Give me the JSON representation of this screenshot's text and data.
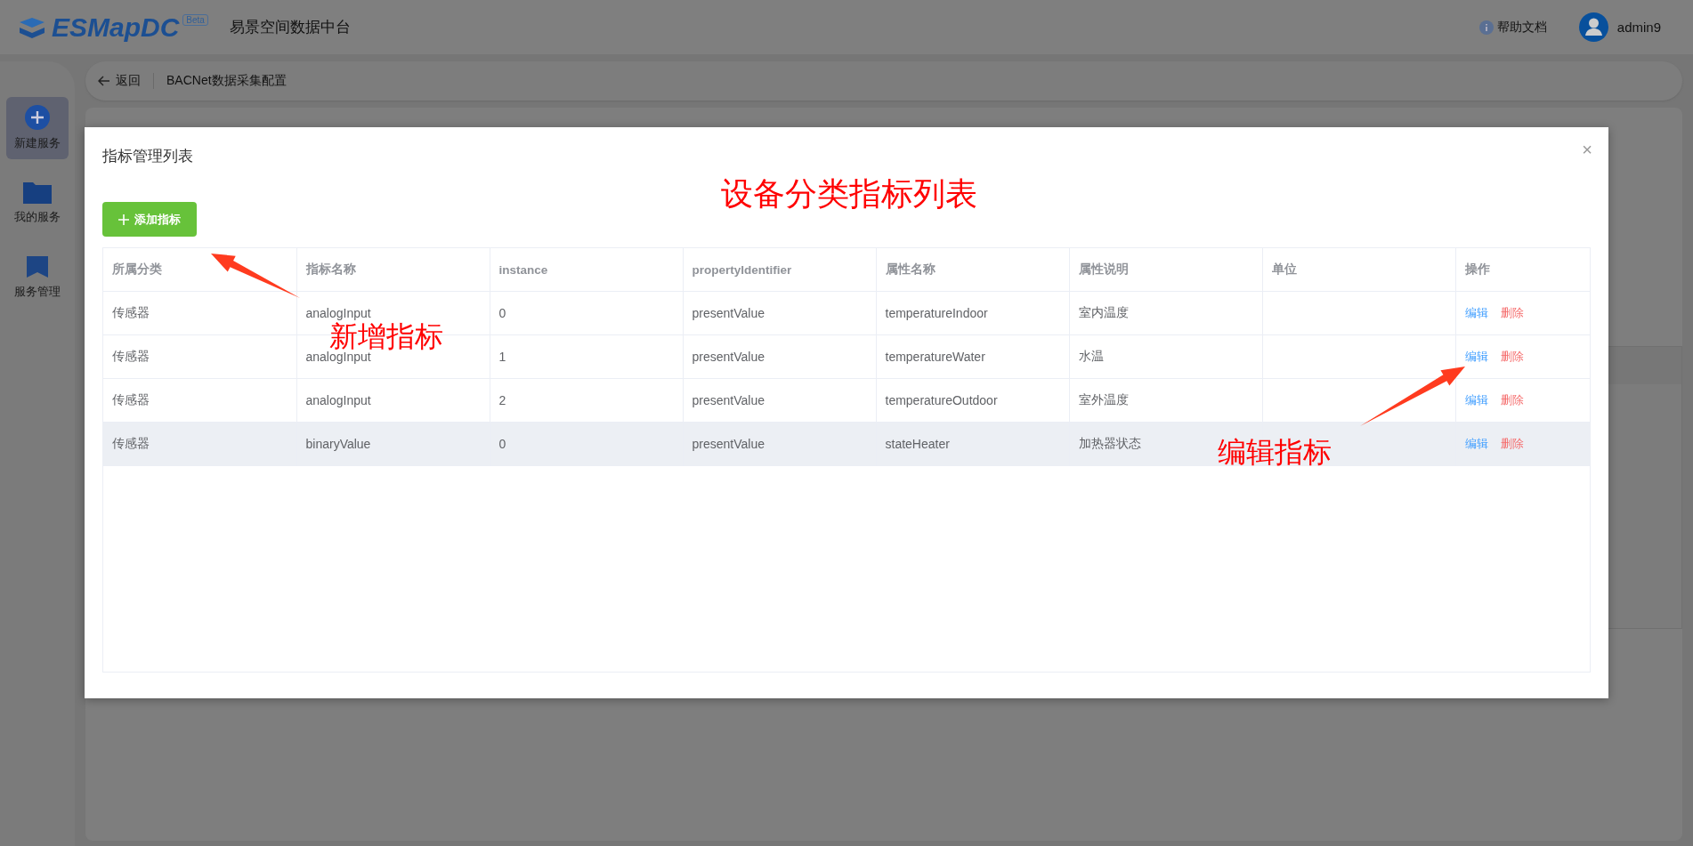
{
  "header": {
    "logo": "ESMapDC",
    "badge": "Beta",
    "title": "易景空间数据中台",
    "help": "帮助文档",
    "user": "admin9"
  },
  "sidebar": {
    "items": [
      {
        "label": "新建服务",
        "kind": "add",
        "selected": true
      },
      {
        "label": "我的服务",
        "kind": "folder",
        "selected": false
      },
      {
        "label": "服务管理",
        "kind": "bookmark",
        "selected": false
      }
    ]
  },
  "breadcrumb": {
    "back": "返回",
    "title": "BACNet数据采集配置"
  },
  "modal": {
    "title": "指标管理列表",
    "close": "×",
    "add_button": "添加指标",
    "table": {
      "columns": [
        "所属分类",
        "指标名称",
        "instance",
        "propertyIdentifier",
        "属性名称",
        "属性说明",
        "单位",
        "操作"
      ],
      "rows": [
        {
          "category": "传感器",
          "name": "analogInput",
          "instance": "0",
          "property_identifier": "presentValue",
          "attribute_name": "temperatureIndoor",
          "attribute_desc": "室内温度",
          "actions": [
            "编辑",
            "删除"
          ],
          "highlighted": false
        },
        {
          "category": "传感器",
          "name": "analogInput",
          "instance": "1",
          "property_identifier": "presentValue",
          "attribute_name": "temperatureWater",
          "attribute_desc": "水温",
          "actions": [
            "编辑",
            "删除"
          ],
          "highlighted": false
        },
        {
          "category": "传感器",
          "name": "analogInput",
          "instance": "2",
          "property_identifier": "presentValue",
          "attribute_name": "temperatureOutdoor",
          "attribute_desc": "室外温度",
          "actions": [
            "编辑",
            "删除"
          ],
          "highlighted": false
        },
        {
          "category": "传感器",
          "name": "binaryValue",
          "instance": "0",
          "property_identifier": "presentValue",
          "attribute_name": "stateHeater",
          "attribute_desc": "加热器状态",
          "actions": [
            "编辑",
            "删除"
          ],
          "highlighted": true
        }
      ]
    }
  },
  "annotations": [
    {
      "text": "设备分类指标列表",
      "kind": "caption"
    },
    {
      "text": "新增指标",
      "kind": "callout"
    },
    {
      "text": "编辑指标",
      "kind": "callout"
    }
  ]
}
